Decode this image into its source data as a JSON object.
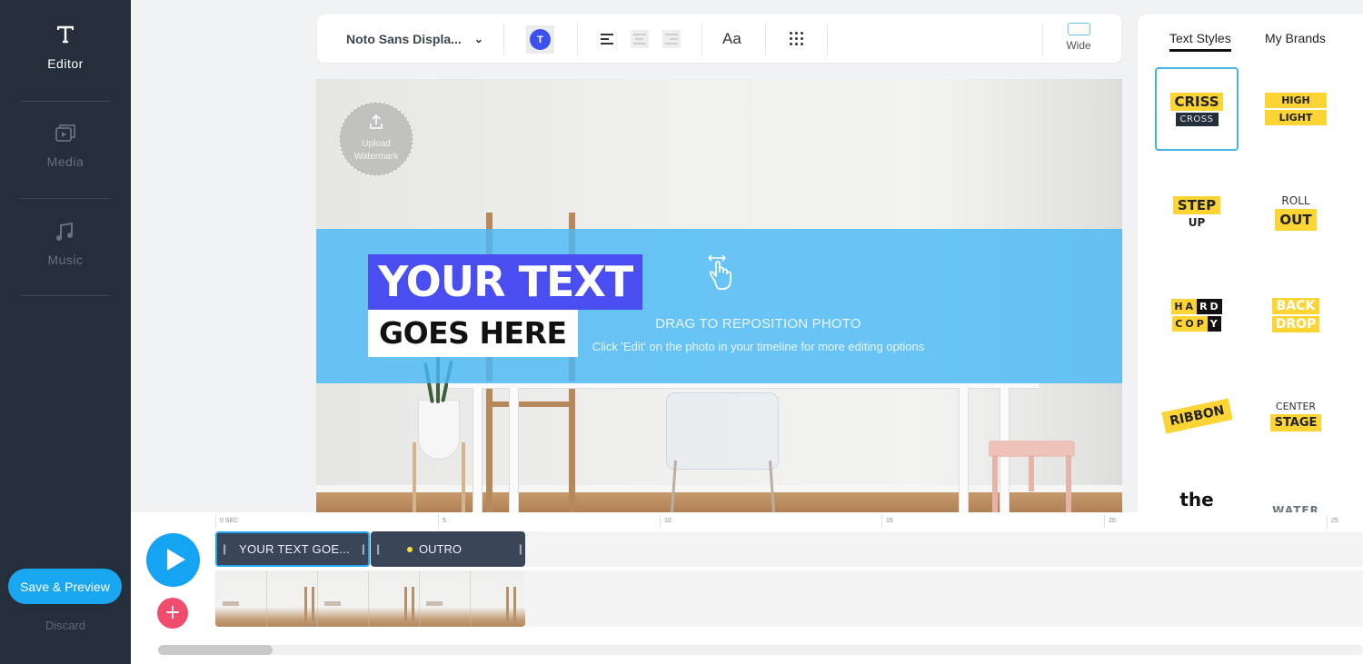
{
  "sidebar": {
    "items": [
      {
        "label": "Editor",
        "icon": "text-icon",
        "active": true
      },
      {
        "label": "Media",
        "icon": "media-icon",
        "active": false
      },
      {
        "label": "Music",
        "icon": "music-note-icon",
        "active": false
      }
    ],
    "save_label": "Save & Preview",
    "discard_label": "Discard"
  },
  "toolbar": {
    "font_name": "Noto Sans Displa...",
    "color_letter": "T",
    "text_color": "#3d51f0",
    "case_label": "Aa",
    "aspect_label": "Wide"
  },
  "canvas": {
    "watermark_line1": "Upload",
    "watermark_line2": "Watermark",
    "drag_title": "DRAG TO REPOSITION PHOTO",
    "drag_subtitle": "Click 'Edit' on the photo in your timeline for more editing options",
    "text_line1": "YOUR TEXT",
    "text_line2": "GOES HERE",
    "overlay_color": "#48b9f5",
    "highlight_color": "#4a4ef0"
  },
  "panel": {
    "tabs": [
      {
        "label": "Text Styles",
        "active": true
      },
      {
        "label": "My Brands",
        "active": false
      }
    ],
    "styles": {
      "crisscross": [
        "CRISS",
        "CROSS"
      ],
      "highlight": [
        "HIGH",
        "LIGHT"
      ],
      "stepup": [
        "STEP",
        "UP"
      ],
      "rollout": [
        "ROLL",
        "OUT"
      ],
      "hardcopy": {
        "line1_plain": "HA",
        "line1_dark": "RD",
        "line2_plain": "COP",
        "line2_dark": "Y"
      },
      "backdrop": [
        "BACK",
        "DROP"
      ],
      "ribbon": "RIBBON",
      "centerstage": [
        "CENTER",
        "STAGE"
      ],
      "the": "the",
      "water": "WATER"
    },
    "accent_yellow": "#fcd535"
  },
  "timeline": {
    "ruler": [
      "0 SEC",
      "5",
      "10",
      "15",
      "20",
      "25"
    ],
    "clips": [
      {
        "label": "YOUR TEXT GOE...",
        "selected": true
      },
      {
        "label": "OUTRO",
        "selected": false
      }
    ],
    "scroll_position_fraction": 0.0
  }
}
